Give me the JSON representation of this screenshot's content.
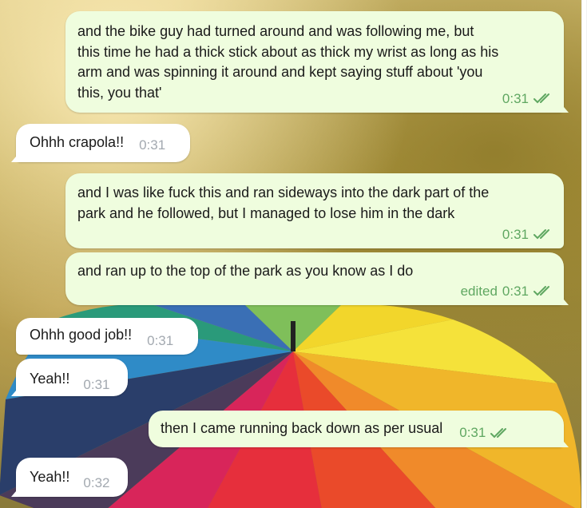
{
  "colors": {
    "outgoing_bubble": "#effdde",
    "incoming_bubble": "#ffffff",
    "outgoing_meta": "#5fa761",
    "incoming_meta": "#a3a9b0"
  },
  "messages": [
    {
      "direction": "out",
      "lines": [
        "and the bike guy had turned around and was following me, but",
        "this time he had a thick stick about as thick my wrist as long as his",
        "arm and was spinning it around and kept saying stuff about 'you",
        "this, you that'"
      ],
      "time": "0:31",
      "status_icon": "double-check-icon"
    },
    {
      "direction": "in",
      "text": "Ohhh crapola!!",
      "time": "0:31"
    },
    {
      "direction": "out",
      "lines": [
        "and I was like fuck this and ran sideways into the dark part of the",
        "park and he followed, but I managed to lose him in the dark"
      ],
      "time": "0:31",
      "status_icon": "double-check-icon"
    },
    {
      "direction": "out",
      "lines": [
        "and ran up to the top of the park as you know as I do"
      ],
      "edited_label": "edited",
      "time": "0:31",
      "status_icon": "double-check-icon"
    },
    {
      "direction": "in",
      "text": "Ohhh good job!!",
      "time": "0:31"
    },
    {
      "direction": "in",
      "text": "Yeah!!",
      "time": "0:31"
    },
    {
      "direction": "out",
      "text": "then I came running back down as per usual",
      "time": "0:31",
      "status_icon": "double-check-icon"
    },
    {
      "direction": "in",
      "text": "Yeah!!",
      "time": "0:32"
    }
  ]
}
